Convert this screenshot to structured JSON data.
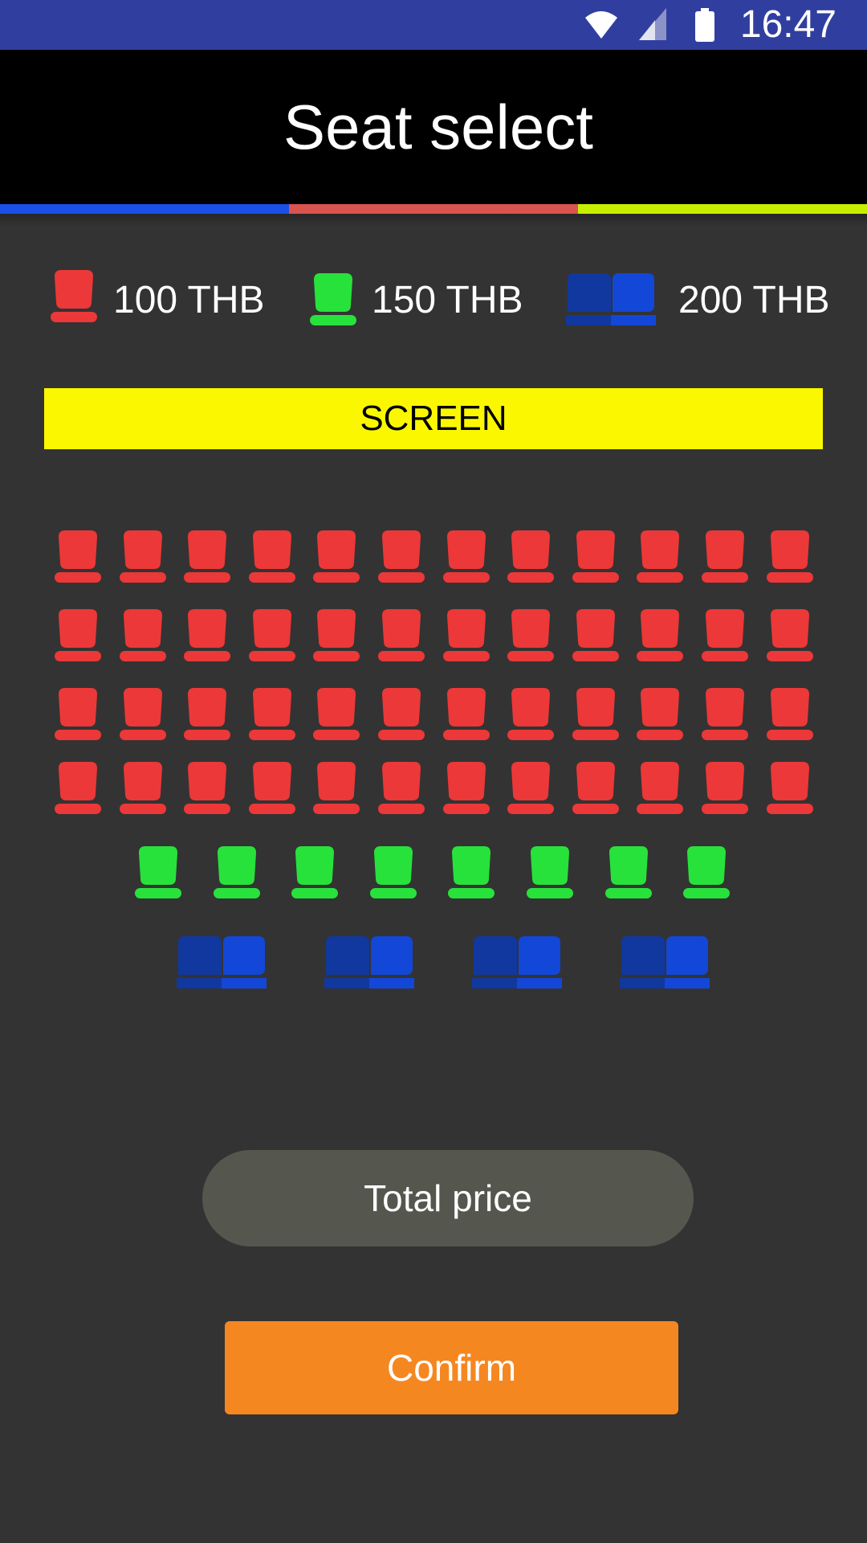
{
  "status_bar": {
    "time": "16:47",
    "icons": [
      "wifi-icon",
      "signal-icon",
      "battery-icon"
    ]
  },
  "app_bar": {
    "title": "Seat select",
    "accent_stripe": [
      "#1a4fe8",
      "#d9534f",
      "#c6ef00"
    ]
  },
  "legend": [
    {
      "label": "100 THB",
      "seat_type": "single",
      "color": "#ec3838"
    },
    {
      "label": "150 THB",
      "seat_type": "single",
      "color": "#27e23b"
    },
    {
      "label": "200 THB",
      "seat_type": "couple",
      "color": "#1347d8"
    }
  ],
  "screen_label": "SCREEN",
  "seating": {
    "rows": [
      {
        "type": "single",
        "color": "#ec3838",
        "count": 12
      },
      {
        "type": "single",
        "color": "#ec3838",
        "count": 12
      },
      {
        "type": "single",
        "color": "#ec3838",
        "count": 12
      },
      {
        "type": "single",
        "color": "#ec3838",
        "count": 12
      },
      {
        "type": "single",
        "color": "#27e23b",
        "count": 8
      },
      {
        "type": "couple",
        "color": "#1347d8",
        "count": 4
      }
    ]
  },
  "total_price_label": "Total price",
  "confirm_label": "Confirm"
}
